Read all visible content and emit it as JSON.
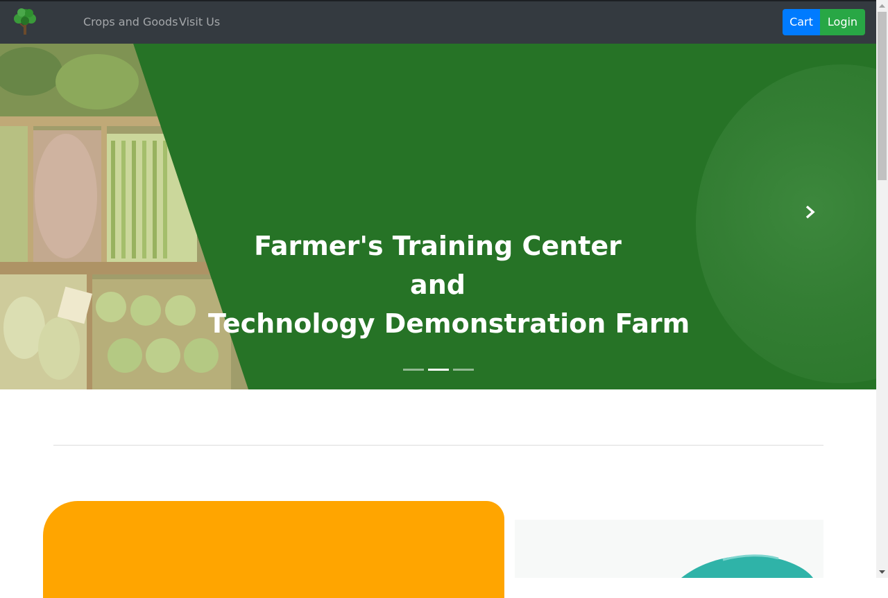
{
  "nav": {
    "links": [
      "Crops and Goods",
      "Visit Us"
    ],
    "cart_label": "Cart",
    "login_label": "Login"
  },
  "hero": {
    "title_lines": [
      "Farmer's Training Center",
      "and",
      "Technology Demonstration Farm"
    ],
    "slide_count": 3,
    "active_slide": 2
  },
  "colors": {
    "navbar": "#343a40",
    "hero_green": "#267326",
    "cart_blue": "#007bff",
    "login_green": "#28a745",
    "card_orange": "#ffa500"
  },
  "icons": {
    "brand": "tree-logo-icon",
    "next": "chevron-right-icon"
  }
}
